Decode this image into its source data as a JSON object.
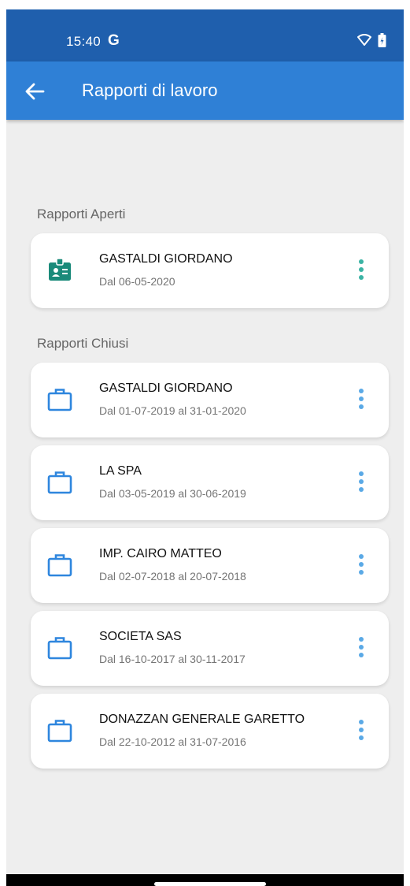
{
  "status_bar": {
    "time": "15:40",
    "g_label": "G",
    "icons": [
      "wifi-icon",
      "battery-charging-icon"
    ]
  },
  "app_bar": {
    "title": "Rapporti di lavoro",
    "back_icon": "arrow-back-icon"
  },
  "open_section": {
    "title": "Rapporti Aperti",
    "items": [
      {
        "name": "GASTALDI GIORDANO",
        "dates": "Dal 06-05-2020",
        "icon": "badge-icon"
      }
    ]
  },
  "closed_section": {
    "title": "Rapporti Chiusi",
    "items": [
      {
        "name": "GASTALDI GIORDANO",
        "dates": "Dal 01-07-2019 al 31-01-2020",
        "icon": "briefcase-icon"
      },
      {
        "name": "LA SPA",
        "dates": "Dal 03-05-2019 al 30-06-2019",
        "icon": "briefcase-icon"
      },
      {
        "name": "IMP. CAIRO MATTEO",
        "dates": "Dal 02-07-2018 al 20-07-2018",
        "icon": "briefcase-icon"
      },
      {
        "name": "SOCIETA SAS",
        "dates": "Dal 16-10-2017 al 30-11-2017",
        "icon": "briefcase-icon"
      },
      {
        "name": "DONAZZAN GENERALE GARETTO",
        "dates": "Dal 22-10-2012 al 31-07-2016",
        "icon": "briefcase-icon"
      }
    ]
  },
  "colors": {
    "status_bar": "#1f5fad",
    "app_bar": "#2f80d6",
    "background": "#eeeeee",
    "open_icon": "#1a8a7a",
    "closed_icon": "#2e86de",
    "open_menu": "#3bb3a4",
    "closed_menu": "#5aa9e6"
  }
}
